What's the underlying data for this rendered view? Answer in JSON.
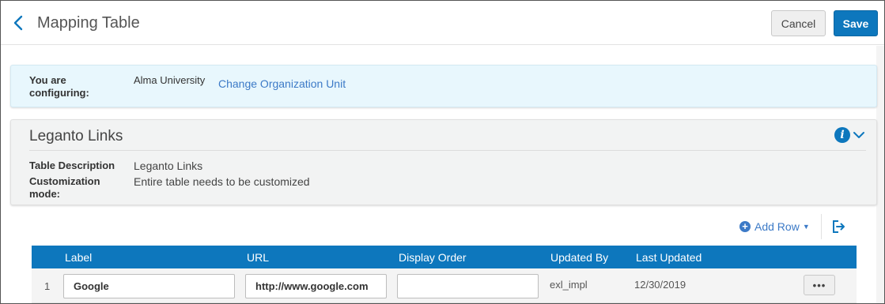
{
  "header": {
    "title": "Mapping Table",
    "cancel_label": "Cancel",
    "save_label": "Save"
  },
  "config": {
    "label": "You are configuring:",
    "value": "Alma University",
    "link": "Change Organization Unit"
  },
  "details": {
    "title": "Leganto Links",
    "fields": [
      {
        "label": "Table Description",
        "value": "Leganto Links"
      },
      {
        "label": "Customization mode:",
        "value": "Entire table needs to be customized"
      }
    ]
  },
  "toolbar": {
    "add_row_label": "Add Row"
  },
  "table": {
    "columns": [
      "Label",
      "URL",
      "Display Order",
      "Updated By",
      "Last Updated"
    ],
    "rows": [
      {
        "num": "1",
        "label": "Google",
        "url": "http://www.google.com",
        "display_order": "",
        "updated_by": "exl_impl",
        "last_updated": "12/30/2019",
        "actions": "•••"
      }
    ]
  },
  "icons": {
    "back": "chevron-left-icon",
    "info": "info-icon",
    "collapse": "chevron-down-icon",
    "add": "plus-circle-icon",
    "export": "export-icon",
    "actions": "more-horizontal-icon"
  },
  "colors": {
    "primary": "#0d77bd",
    "link": "#3c7ac7",
    "config_bg": "#e8f7fd",
    "details_bg": "#f2f3f3"
  }
}
